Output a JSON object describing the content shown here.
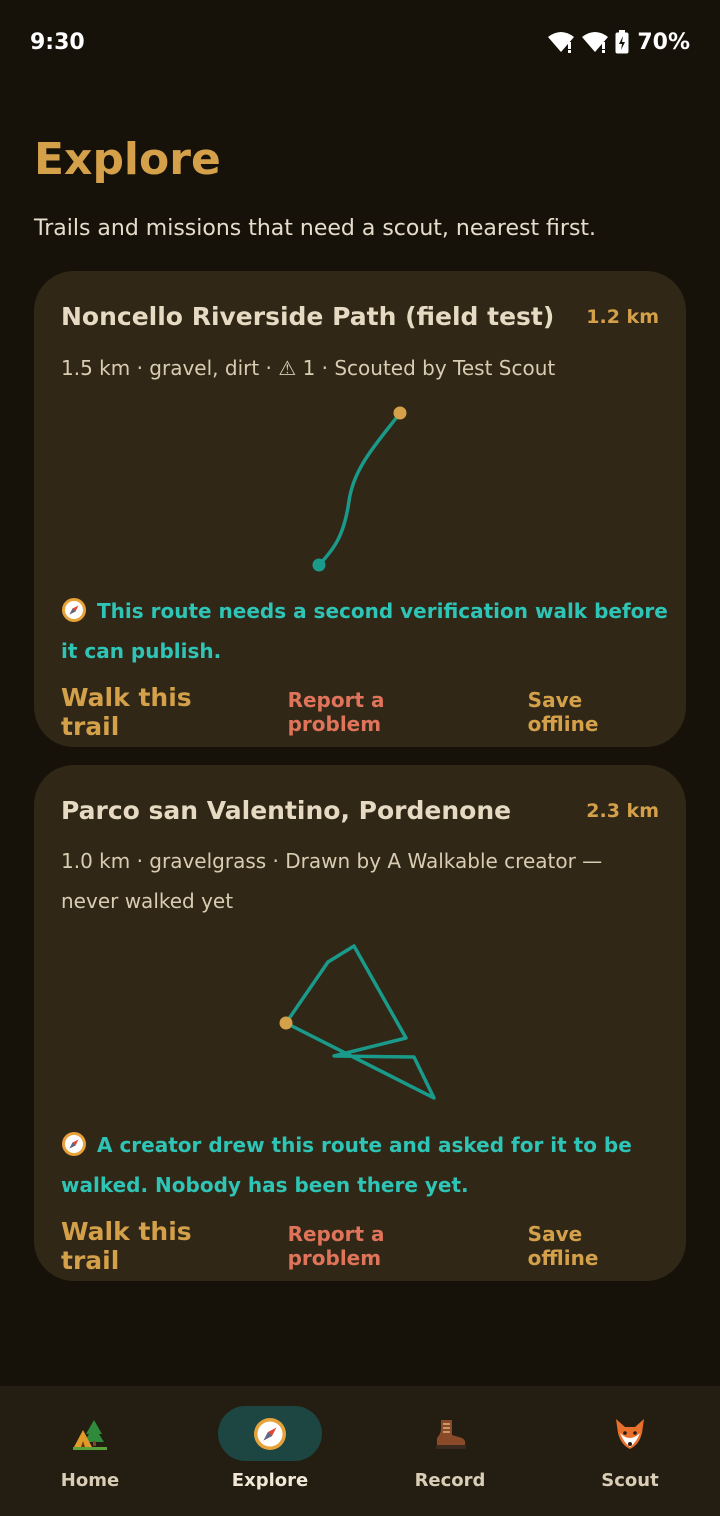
{
  "status_bar": {
    "time": "9:30",
    "battery": "70%"
  },
  "header": {
    "title": "Explore",
    "subtitle": "Trails and missions that need a scout, nearest first."
  },
  "cards": [
    {
      "title": "Noncello Riverside Path (field test)",
      "distance": "1.2 km",
      "meta": "1.5 km · gravel, dirt · ⚠ 1 · Scouted by Test Scout",
      "note": "This route needs a second verification walk before it can publish.",
      "note_icon": "compass-icon",
      "actions": {
        "walk": "Walk this trail",
        "report": "Report a problem",
        "save": "Save offline"
      }
    },
    {
      "title": "Parco san Valentino, Pordenone",
      "distance": "2.3 km",
      "meta": "1.0 km · gravelgrass · Drawn by A Walkable creator — never walked yet",
      "note": "A creator drew this route and asked for it to be walked. Nobody has been there yet.",
      "note_icon": "compass-icon",
      "actions": {
        "walk": "Walk this trail",
        "report": "Report a problem",
        "save": "Save offline"
      }
    }
  ],
  "nav": {
    "items": [
      {
        "label": "Home",
        "icon": "camping-icon"
      },
      {
        "label": "Explore",
        "icon": "compass-icon",
        "active": true
      },
      {
        "label": "Record",
        "icon": "hiking-boot-icon"
      },
      {
        "label": "Scout",
        "icon": "fox-icon"
      }
    ]
  },
  "colors": {
    "background": "#171209",
    "card": "#302716",
    "accent": "#d4a049",
    "route": "#1a9a8a",
    "note": "#2ec4b6",
    "report": "#e0745a",
    "nav_active": "#1d4642"
  }
}
